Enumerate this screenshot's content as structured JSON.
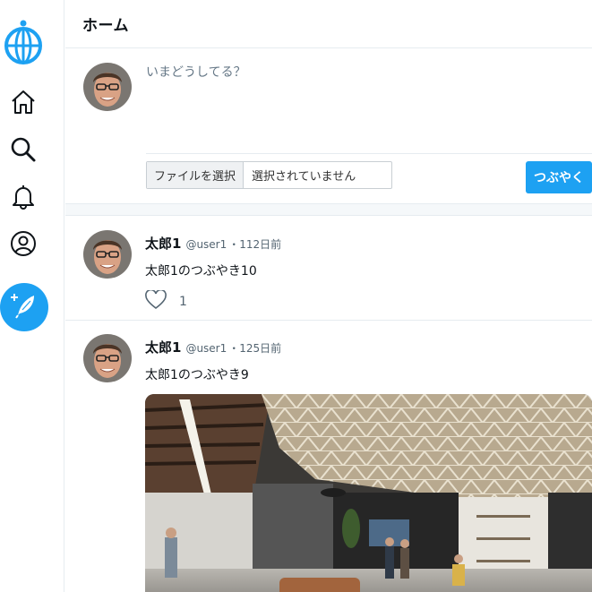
{
  "nav": {
    "items": [
      {
        "name": "home",
        "icon": "home-icon"
      },
      {
        "name": "search",
        "icon": "search-icon"
      },
      {
        "name": "notifications",
        "icon": "bell-icon"
      },
      {
        "name": "profile",
        "icon": "user-circle-icon"
      }
    ],
    "compose_icon": "feather-plus-icon",
    "logo_icon": "globe-icon"
  },
  "header": {
    "title": "ホーム"
  },
  "composer": {
    "placeholder": "いまどうしてる？",
    "file_button_label": "ファイルを選択",
    "file_status": "選択されていません",
    "submit_label": "つぶやく"
  },
  "tweets": [
    {
      "name": "太郎1",
      "handle": "@user1",
      "time": "・112日前",
      "text": "太郎1のつぶやき10",
      "like_count": "1",
      "has_image": false
    },
    {
      "name": "太郎1",
      "handle": "@user1",
      "time": "・125日前",
      "text": "太郎1のつぶやき9",
      "has_image": true,
      "image_description": "office-lobby-photo"
    }
  ],
  "colors": {
    "accent": "#1da1f2",
    "border": "#e6ecf0",
    "muted": "#536471"
  }
}
